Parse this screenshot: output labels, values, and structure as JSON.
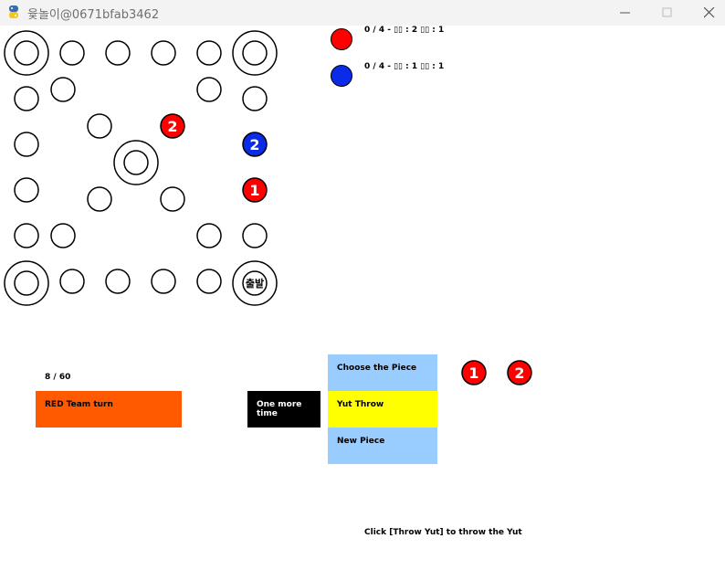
{
  "window": {
    "title": "윷놀이@0671bfab3462",
    "icon": "python-snake-icon"
  },
  "board": {
    "start_label": "출발",
    "pieces_on_board": [
      {
        "team": "red",
        "number": "2"
      },
      {
        "team": "blue",
        "number": "2"
      },
      {
        "team": "red",
        "number": "1"
      }
    ]
  },
  "teams": [
    {
      "color": "#ff0000",
      "status": "0 / 4 - ▯▯ : 2   ▯▯ : 1"
    },
    {
      "color": "#0a2be8",
      "status": "0 / 4 - ▯▯ : 1   ▯▯ : 1"
    }
  ],
  "game": {
    "turn_counter": "8 / 60",
    "turn_label": "RED Team turn",
    "turn_color": "#ff5a00",
    "bonus_label": "One more time",
    "instruction": "Click [Throw Yut] to throw the Yut"
  },
  "menu": {
    "choose_piece": "Choose the Piece",
    "yut_throw": "Yut Throw",
    "new_piece": "New Piece"
  },
  "selectable_pieces": [
    "1",
    "2"
  ],
  "colors": {
    "red": "#ff0000",
    "blue": "#0a2be8",
    "menu_blue": "#99ccff",
    "menu_yellow": "#ffff00"
  }
}
